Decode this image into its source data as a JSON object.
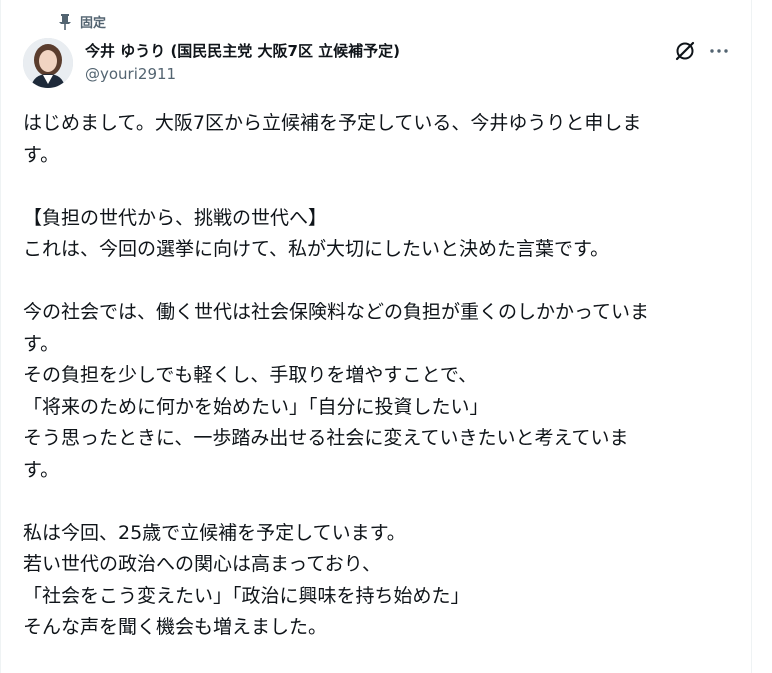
{
  "pinned_label": "固定",
  "author": {
    "display_name": "今井 ゆうり (国民民主党 大阪7区 立候補予定)",
    "handle": "@youri2911"
  },
  "icons": {
    "pin": "pin-icon",
    "grok": "grok-icon",
    "more": "more-icon"
  },
  "post": {
    "lines": [
      "はじめまして。大阪7区から立候補を予定している、今井ゆうりと申しま",
      "す。",
      "",
      "【負担の世代から、挑戦の世代へ】",
      "これは、今回の選挙に向けて、私が大切にしたいと決めた言葉です。",
      "",
      "今の社会では、働く世代は社会保険料などの負担が重くのしかかっていま",
      "す。",
      "その負担を少しでも軽くし、手取りを増やすことで、",
      "「将来のために何かを始めたい」「自分に投資したい」",
      "そう思ったときに、一歩踏み出せる社会に変えていきたいと考えていま",
      "す。",
      "",
      "私は今回、25歳で立候補を予定しています。",
      "若い世代の政治への関心は高まっており、",
      "「社会をこう変えたい」「政治に興味を持ち始めた」",
      "そんな声を聞く機会も増えました。"
    ]
  }
}
